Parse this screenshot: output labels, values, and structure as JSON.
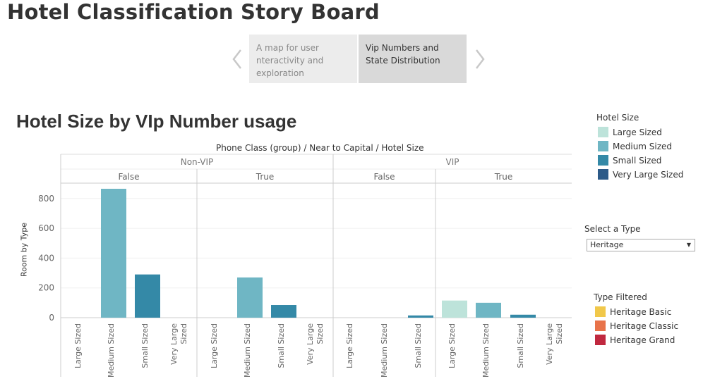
{
  "story": {
    "title": "Hotel Classification Story Board",
    "points": [
      "A map for user nteractivity and exploration",
      "Vip Numbers and State Distribution"
    ]
  },
  "sheet": {
    "title": "Hotel Size by VIp Number usage",
    "column_header": "Phone Class (group)  /  Near to Capital  /  Hotel Size"
  },
  "legend_size": {
    "title": "Hotel Size",
    "items": [
      {
        "label": "Large Sized",
        "color": "#bde3da"
      },
      {
        "label": "Medium Sized",
        "color": "#6fb6c4"
      },
      {
        "label": "Small Sized",
        "color": "#3489a7"
      },
      {
        "label": "Very Large Sized",
        "color": "#2c5a88"
      }
    ]
  },
  "filter": {
    "title": "Select a Type",
    "value": "Heritage"
  },
  "legend_type": {
    "title": "Type Filtered",
    "items": [
      {
        "label": "Heritage Basic",
        "color": "#f1c84a"
      },
      {
        "label": "Heritage Classic",
        "color": "#e8734a"
      },
      {
        "label": "Heritage Grand",
        "color": "#c0283f"
      }
    ]
  },
  "chart_data": {
    "type": "bar",
    "ylabel": "Room by Type",
    "ylim": [
      0,
      900
    ],
    "yticks": [
      0,
      200,
      400,
      600,
      800
    ],
    "grid": true,
    "groups": [
      {
        "phone_class": "Non-VIP",
        "near_to_capital": "False",
        "categories": [
          "Large Sized",
          "Medium Sized",
          "Small Sized",
          "Very Large Sized"
        ],
        "values": [
          0,
          865,
          290,
          0
        ]
      },
      {
        "phone_class": "Non-VIP",
        "near_to_capital": "True",
        "categories": [
          "Large Sized",
          "Medium Sized",
          "Small Sized",
          "Very Large Sized"
        ],
        "values": [
          0,
          270,
          85,
          0
        ]
      },
      {
        "phone_class": "VIP",
        "near_to_capital": "False",
        "categories": [
          "Large Sized",
          "Medium Sized",
          "Small Sized"
        ],
        "values": [
          0,
          0,
          15
        ]
      },
      {
        "phone_class": "VIP",
        "near_to_capital": "True",
        "categories": [
          "Large Sized",
          "Medium Sized",
          "Small Sized",
          "Very Large Sized"
        ],
        "values": [
          115,
          100,
          20,
          0
        ]
      }
    ]
  }
}
